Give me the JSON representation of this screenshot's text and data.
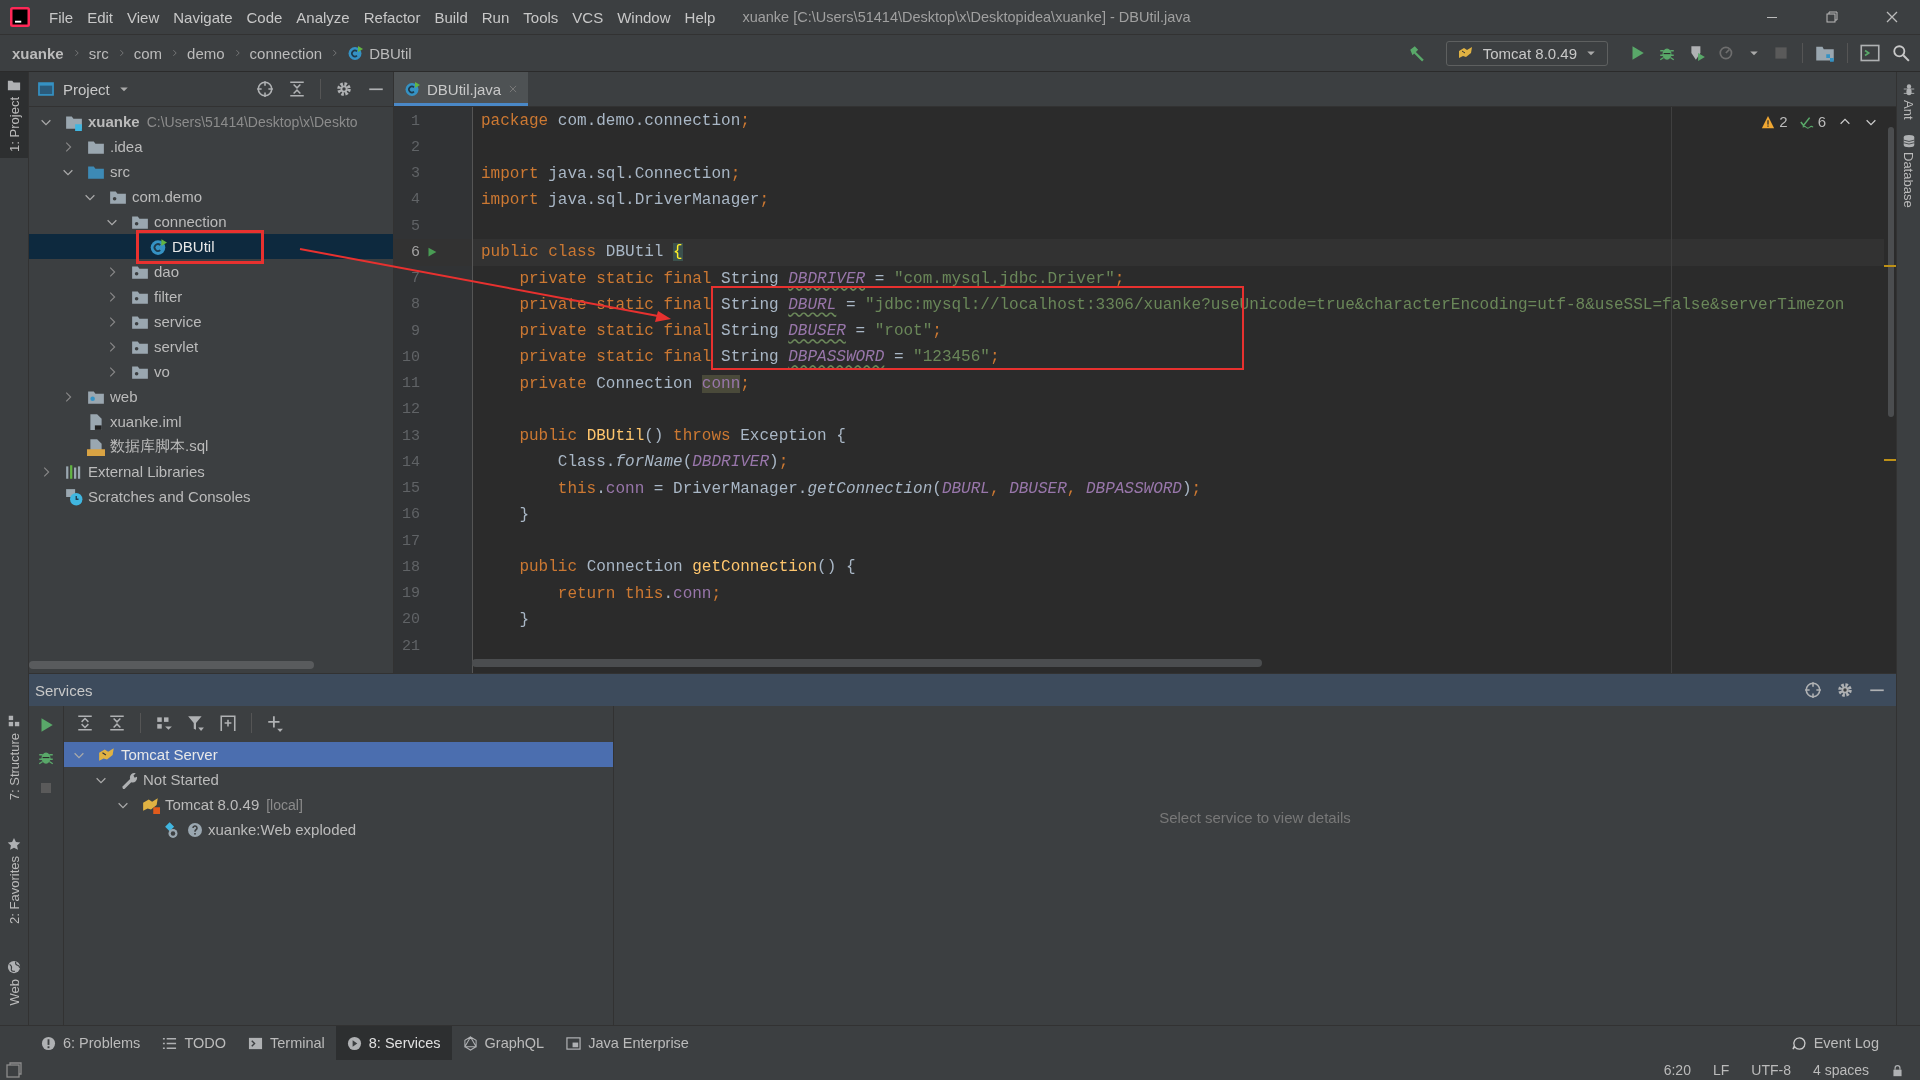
{
  "window": {
    "title": "xuanke [C:\\Users\\51414\\Desktop\\x\\Desktopidea\\xuanke] - DBUtil.java"
  },
  "menu": [
    "File",
    "Edit",
    "View",
    "Navigate",
    "Code",
    "Analyze",
    "Refactor",
    "Build",
    "Run",
    "Tools",
    "VCS",
    "Window",
    "Help"
  ],
  "breadcrumbs": [
    {
      "label": "xuanke",
      "kind": "project"
    },
    {
      "label": "src",
      "kind": "dir"
    },
    {
      "label": "com",
      "kind": "dir"
    },
    {
      "label": "demo",
      "kind": "dir"
    },
    {
      "label": "connection",
      "kind": "dir"
    },
    {
      "label": "DBUtil",
      "kind": "class"
    }
  ],
  "run_config": {
    "label": "Tomcat 8.0.49"
  },
  "left_strip": [
    {
      "label": "1: Project",
      "selected": true
    },
    {
      "label": "7: Structure",
      "selected": false
    },
    {
      "label": "2: Favorites",
      "selected": false
    },
    {
      "label": "Web",
      "selected": false
    }
  ],
  "right_strip": [
    "Ant",
    "Database"
  ],
  "project_panel": {
    "title": "Project",
    "tree": [
      {
        "label": "xuanke",
        "note": "C:\\Users\\51414\\Desktop\\x\\Deskto",
        "kind": "module",
        "expanded": true,
        "selected": false,
        "framed": false,
        "children": [
          {
            "label": ".idea",
            "kind": "folder",
            "expanded": false,
            "selected": false,
            "framed": false
          },
          {
            "label": "src",
            "kind": "source",
            "expanded": true,
            "selected": false,
            "framed": false,
            "children": [
              {
                "label": "com.demo",
                "kind": "package",
                "expanded": true,
                "selected": false,
                "framed": false,
                "children": [
                  {
                    "label": "connection",
                    "kind": "package",
                    "expanded": true,
                    "selected": false,
                    "framed": false,
                    "children": [
                      {
                        "label": "DBUtil",
                        "kind": "class",
                        "selected": true,
                        "framed": true
                      }
                    ]
                  },
                  {
                    "label": "dao",
                    "kind": "package",
                    "expanded": false,
                    "selected": false,
                    "framed": false
                  },
                  {
                    "label": "filter",
                    "kind": "package",
                    "expanded": false,
                    "selected": false,
                    "framed": false
                  },
                  {
                    "label": "service",
                    "kind": "package",
                    "expanded": false,
                    "selected": false,
                    "framed": false
                  },
                  {
                    "label": "servlet",
                    "kind": "package",
                    "expanded": false,
                    "selected": false,
                    "framed": false
                  },
                  {
                    "label": "vo",
                    "kind": "package",
                    "expanded": false,
                    "selected": false,
                    "framed": false
                  }
                ]
              }
            ]
          },
          {
            "label": "web",
            "kind": "web",
            "expanded": false,
            "selected": false,
            "framed": false
          },
          {
            "label": "xuanke.iml",
            "kind": "iml",
            "selected": false,
            "framed": false
          },
          {
            "label": "数据库脚本.sql",
            "kind": "sql",
            "selected": false,
            "framed": false
          }
        ]
      },
      {
        "label": "External Libraries",
        "kind": "libraries",
        "expanded": false,
        "selected": false,
        "framed": false
      },
      {
        "label": "Scratches and Consoles",
        "kind": "scratches",
        "selected": false,
        "framed": false
      }
    ]
  },
  "editor": {
    "tabs": [
      {
        "label": "DBUtil.java",
        "selected": true
      }
    ],
    "inspections": {
      "warnings": "2",
      "typos": "6"
    },
    "code_frame": true,
    "arrow": true,
    "lines": [
      {
        "number": "1",
        "current": false,
        "run": false,
        "tokens": [
          {
            "kind": "kw",
            "text": "package"
          },
          {
            "kind": "pl",
            "text": " com.demo.connection"
          },
          {
            "kind": "kw",
            "text": ";"
          }
        ]
      },
      {
        "number": "2",
        "current": false,
        "run": false
      },
      {
        "number": "3",
        "current": false,
        "run": false,
        "tokens": [
          {
            "kind": "kw",
            "text": "import"
          },
          {
            "kind": "pl",
            "text": " java.sql.Connection"
          },
          {
            "kind": "kw",
            "text": ";"
          }
        ]
      },
      {
        "number": "4",
        "current": false,
        "run": false,
        "tokens": [
          {
            "kind": "kw",
            "text": "import"
          },
          {
            "kind": "pl",
            "text": " java.sql.DriverManager"
          },
          {
            "kind": "kw",
            "text": ";"
          }
        ]
      },
      {
        "number": "5",
        "current": false,
        "run": false
      },
      {
        "number": "6",
        "current": true,
        "run": true,
        "tokens": [
          {
            "kind": "kw",
            "text": "public class "
          },
          {
            "kind": "pl",
            "text": "DBUtil "
          },
          {
            "kind": "brace",
            "text": "{"
          }
        ]
      },
      {
        "number": "7",
        "current": false,
        "run": false,
        "tokens": [
          {
            "kind": "kw",
            "text": "    private static final "
          },
          {
            "kind": "pl",
            "text": "String "
          },
          {
            "kind": "cdecl",
            "text": "DBDRIVER"
          },
          {
            "kind": "pl",
            "text": " = "
          },
          {
            "kind": "str",
            "text": "\"com.mysql.jdbc.Driver\""
          },
          {
            "kind": "kw",
            "text": ";"
          }
        ]
      },
      {
        "number": "8",
        "current": false,
        "run": false,
        "tokens": [
          {
            "kind": "kw",
            "text": "    private static final "
          },
          {
            "kind": "pl",
            "text": "String "
          },
          {
            "kind": "cdecl",
            "text": "DBURL"
          },
          {
            "kind": "pl",
            "text": " = "
          },
          {
            "kind": "str",
            "text": "\"jdbc:mysql://localhost:3306/xuanke?useUnicode=true&characterEncoding=utf-8&useSSL=false&serverTimezon"
          }
        ]
      },
      {
        "number": "9",
        "current": false,
        "run": false,
        "tokens": [
          {
            "kind": "kw",
            "text": "    private static final "
          },
          {
            "kind": "pl",
            "text": "String "
          },
          {
            "kind": "cdecl",
            "text": "DBUSER"
          },
          {
            "kind": "pl",
            "text": " = "
          },
          {
            "kind": "str",
            "text": "\"root\""
          },
          {
            "kind": "kw",
            "text": ";"
          }
        ]
      },
      {
        "number": "10",
        "current": false,
        "run": false,
        "tokens": [
          {
            "kind": "kw",
            "text": "    private static final "
          },
          {
            "kind": "pl",
            "text": "String "
          },
          {
            "kind": "cdecl",
            "text": "DBPASSWORD"
          },
          {
            "kind": "pl",
            "text": " = "
          },
          {
            "kind": "str",
            "text": "\"123456\""
          },
          {
            "kind": "kw",
            "text": ";"
          }
        ]
      },
      {
        "number": "11",
        "current": false,
        "run": false,
        "tokens": [
          {
            "kind": "kw",
            "text": "    private "
          },
          {
            "kind": "pl",
            "text": "Connection "
          },
          {
            "kind": "unused",
            "text": "conn"
          },
          {
            "kind": "kw",
            "text": ";"
          }
        ]
      },
      {
        "number": "12",
        "current": false,
        "run": false
      },
      {
        "number": "13",
        "current": false,
        "run": false,
        "tokens": [
          {
            "kind": "kw",
            "text": "    public "
          },
          {
            "kind": "fn",
            "text": "DBUtil"
          },
          {
            "kind": "pl",
            "text": "() "
          },
          {
            "kind": "kw",
            "text": "throws "
          },
          {
            "kind": "pl",
            "text": "Exception {"
          }
        ]
      },
      {
        "number": "14",
        "current": false,
        "run": false,
        "tokens": [
          {
            "kind": "pl",
            "text": "        Class."
          },
          {
            "kind": "sm",
            "text": "forName"
          },
          {
            "kind": "pl",
            "text": "("
          },
          {
            "kind": "cst",
            "text": "DBDRIVER"
          },
          {
            "kind": "pl",
            "text": ")"
          },
          {
            "kind": "kw",
            "text": ";"
          }
        ]
      },
      {
        "number": "15",
        "current": false,
        "run": false,
        "tokens": [
          {
            "kind": "kw",
            "text": "        this"
          },
          {
            "kind": "pl",
            "text": "."
          },
          {
            "kind": "fld",
            "text": "conn"
          },
          {
            "kind": "pl",
            "text": " = DriverManager."
          },
          {
            "kind": "sm",
            "text": "getConnection"
          },
          {
            "kind": "pl",
            "text": "("
          },
          {
            "kind": "cst",
            "text": "DBURL"
          },
          {
            "kind": "kw",
            "text": ", "
          },
          {
            "kind": "cst",
            "text": "DBUSER"
          },
          {
            "kind": "kw",
            "text": ", "
          },
          {
            "kind": "cst",
            "text": "DBPASSWORD"
          },
          {
            "kind": "pl",
            "text": ")"
          },
          {
            "kind": "kw",
            "text": ";"
          }
        ]
      },
      {
        "number": "16",
        "current": false,
        "run": false,
        "tokens": [
          {
            "kind": "pl",
            "text": "    }"
          }
        ]
      },
      {
        "number": "17",
        "current": false,
        "run": false
      },
      {
        "number": "18",
        "current": false,
        "run": false,
        "tokens": [
          {
            "kind": "kw",
            "text": "    public "
          },
          {
            "kind": "pl",
            "text": "Connection "
          },
          {
            "kind": "fn",
            "text": "getConnection"
          },
          {
            "kind": "pl",
            "text": "() {"
          }
        ]
      },
      {
        "number": "19",
        "current": false,
        "run": false,
        "tokens": [
          {
            "kind": "kw",
            "text": "        return this"
          },
          {
            "kind": "pl",
            "text": "."
          },
          {
            "kind": "fld",
            "text": "conn"
          },
          {
            "kind": "kw",
            "text": ";"
          }
        ]
      },
      {
        "number": "20",
        "current": false,
        "run": false,
        "tokens": [
          {
            "kind": "pl",
            "text": "    }"
          }
        ]
      },
      {
        "number": "21",
        "current": false,
        "run": false
      }
    ]
  },
  "services": {
    "title": "Services",
    "empty_text": "Select service to view details",
    "tree": [
      {
        "label": "Tomcat Server",
        "kind": "tomcat",
        "expanded": true,
        "selected": true,
        "children": [
          {
            "label": "Not Started",
            "kind": "wrench",
            "expanded": true,
            "selected": false,
            "children": [
              {
                "label": "Tomcat 8.0.49",
                "note": "[local]",
                "kind": "tomcat-local",
                "expanded": true,
                "selected": false,
                "children": [
                  {
                    "label": "xuanke:Web exploded",
                    "kind": "artifact",
                    "selected": false
                  }
                ]
              }
            ]
          }
        ]
      }
    ]
  },
  "bottom_tabs": [
    {
      "label": "6: Problems",
      "kind": "info",
      "selected": false
    },
    {
      "label": "TODO",
      "kind": "list",
      "selected": false
    },
    {
      "label": "Terminal",
      "kind": "terminal",
      "selected": false
    },
    {
      "label": "8: Services",
      "kind": "services",
      "selected": true
    },
    {
      "label": "GraphQL",
      "kind": "graphql",
      "selected": false
    },
    {
      "label": "Java Enterprise",
      "kind": "enterprise",
      "selected": false
    }
  ],
  "event_log": "Event Log",
  "status_bar": [
    "6:20",
    "LF",
    "UTF-8",
    "4 spaces"
  ]
}
